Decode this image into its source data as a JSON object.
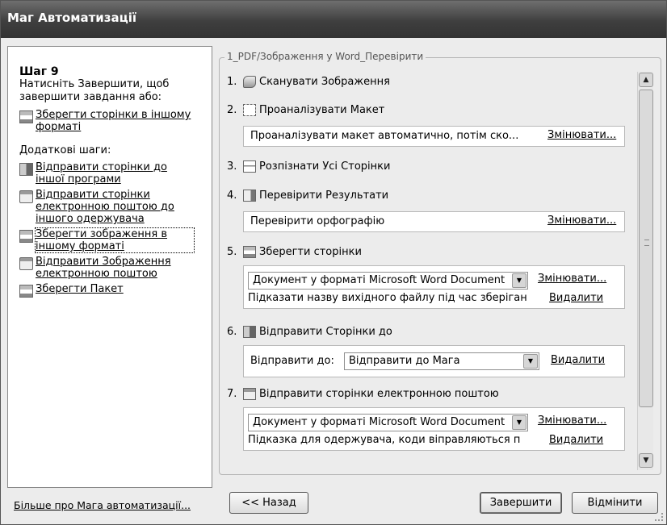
{
  "window": {
    "title": "Маг Автоматизації"
  },
  "left": {
    "step_title": "Шаг 9",
    "step_desc": "Натисніть Завершити, щоб завершити завдання або:",
    "save_other_link": "Зберегти сторінки в іншому форматі",
    "extra_title": "Додаткові шаги:",
    "links": [
      {
        "label": "Відправити сторінки до іншої програми",
        "icon": "send-pages-icon"
      },
      {
        "label": "Відправити сторінки електронною поштою до іншого одержувача",
        "icon": "mail-pages-icon"
      },
      {
        "label": "Зберегти зображення в іншому форматі",
        "icon": "save-image-icon"
      },
      {
        "label": "Відправити Зображення електронною поштою",
        "icon": "mail-image-icon"
      },
      {
        "label": "Зберегти Пакет",
        "icon": "save-package-icon"
      }
    ]
  },
  "workflow": {
    "name": "1_PDF/Зображення у Word_Перевірити",
    "steps": [
      {
        "num": "1.",
        "label": "Сканувати Зображення"
      },
      {
        "num": "2.",
        "label": "Проаналізувати Макет",
        "detail": "Проаналізувати макет автоматично, потім ско...",
        "change": "Змінювати..."
      },
      {
        "num": "3.",
        "label": "Розпізнати Усі Сторінки"
      },
      {
        "num": "4.",
        "label": "Перевірити Результати",
        "detail": "Перевірити орфографію",
        "change": "Змінювати..."
      },
      {
        "num": "5.",
        "label": "Зберегти сторінки",
        "format": "Документ у форматі Microsoft Word Document",
        "change": "Змінювати...",
        "hint": "Підказати назву вихідного файлу під час зберіган",
        "remove": "Видалити"
      },
      {
        "num": "6.",
        "label": "Відправити Сторінки до",
        "send_to_label": "Відправити до:",
        "send_to_value": "Відправити до Мага",
        "remove": "Видалити"
      },
      {
        "num": "7.",
        "label": "Відправити сторінки електронною поштою",
        "format": "Документ у форматі Microsoft Word Document",
        "change": "Змінювати...",
        "hint": "Підказка для одержувача, коди віправляються п",
        "remove": "Видалити"
      }
    ]
  },
  "footer": {
    "more_link": "Більше про Мага автоматизації...",
    "back": "<< Назад",
    "finish": "Завершити",
    "cancel": "Відмінити"
  }
}
